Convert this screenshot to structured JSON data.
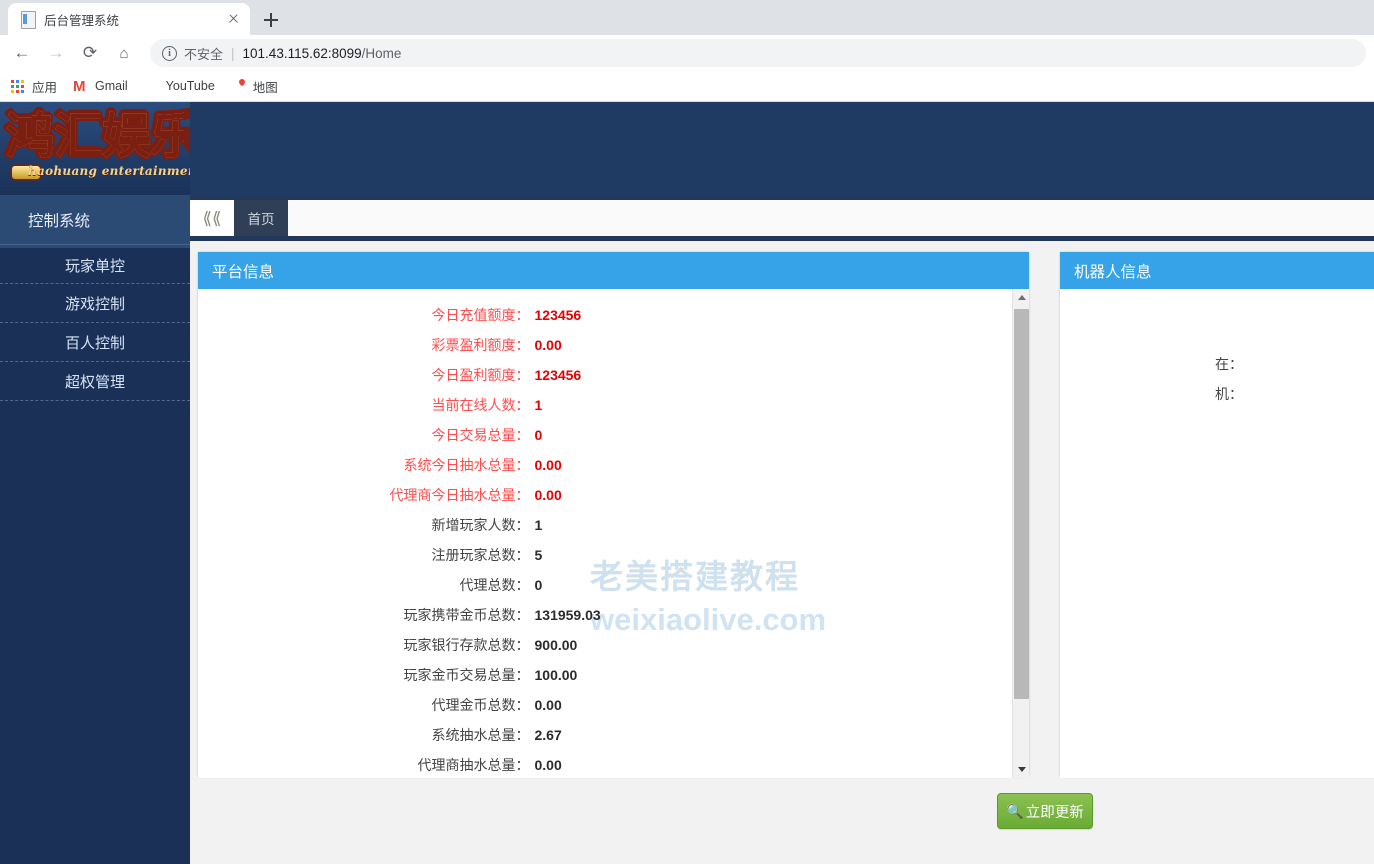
{
  "browser": {
    "tab": {
      "title": "后台管理系统",
      "favicon": "document-icon",
      "close": "close-icon"
    },
    "new_tab": "plus-icon",
    "nav": {
      "back": "arrow-left-icon",
      "forward": "arrow-right-icon",
      "reload": "reload-icon",
      "home": "home-icon"
    },
    "omnibox": {
      "info": "info-icon",
      "security_label": "不安全",
      "separator": "|",
      "host": "101.43.115.62:8099",
      "path": "/Home"
    },
    "bookmarks": [
      {
        "label": "应用",
        "icon": "apps-grid-icon"
      },
      {
        "label": "Gmail",
        "icon": "gmail-icon"
      },
      {
        "label": "YouTube",
        "icon": "youtube-icon"
      },
      {
        "label": "地图",
        "icon": "google-maps-icon"
      }
    ]
  },
  "app": {
    "logo": {
      "text": "鸿汇娱乐",
      "subtitle": "haohuang entertainment"
    },
    "sidebar": {
      "section_label": "控制系统",
      "items": [
        {
          "label": "玩家单控"
        },
        {
          "label": "游戏控制"
        },
        {
          "label": "百人控制"
        },
        {
          "label": "超权管理"
        }
      ]
    },
    "tabbar": {
      "collapse_icon": "chevron-double-left-icon",
      "tabs": [
        {
          "label": "首页",
          "active": true
        }
      ]
    },
    "panels": {
      "left": {
        "title": "平台信息",
        "rows": [
          {
            "label": "今日充值额度",
            "value": "123456",
            "style": "red"
          },
          {
            "label": "彩票盈利额度",
            "value": "0.00",
            "style": "red"
          },
          {
            "label": "今日盈利额度",
            "value": "123456",
            "style": "red"
          },
          {
            "label": "当前在线人数",
            "value": "1",
            "style": "red"
          },
          {
            "label": "今日交易总量",
            "value": "0",
            "style": "red"
          },
          {
            "label": "系统今日抽水总量",
            "value": "0.00",
            "style": "red"
          },
          {
            "label": "代理商今日抽水总量",
            "value": "0.00",
            "style": "red"
          },
          {
            "label": "新增玩家人数",
            "value": "1",
            "style": "dark"
          },
          {
            "label": "注册玩家总数",
            "value": "5",
            "style": "dark"
          },
          {
            "label": "代理总数",
            "value": "0",
            "style": "dark"
          },
          {
            "label": "玩家携带金币总数",
            "value": "131959.03",
            "style": "dark"
          },
          {
            "label": "玩家银行存款总数",
            "value": "900.00",
            "style": "dark"
          },
          {
            "label": "玩家金币交易总量",
            "value": "100.00",
            "style": "dark"
          },
          {
            "label": "代理金币总数",
            "value": "0.00",
            "style": "dark"
          },
          {
            "label": "系统抽水总量",
            "value": "2.67",
            "style": "dark"
          },
          {
            "label": "代理商抽水总量",
            "value": "0.00",
            "style": "dark"
          }
        ],
        "scrollbar": {
          "up": "triangle-up-icon",
          "down": "triangle-down-icon"
        }
      },
      "right": {
        "title": "机器人信息",
        "rows": [
          {
            "label": "在",
            "value": ""
          },
          {
            "label": "机",
            "value": ""
          }
        ]
      }
    },
    "update_button": {
      "label": "立即更新",
      "icon": "search-icon"
    },
    "watermark": {
      "line1": "老美搭建教程",
      "line2": "weixiaolive.com"
    },
    "colors": {
      "header_navy": "#1f3a63",
      "sidebar_navy": "#1b3057",
      "panel_blue": "#36a3e8",
      "tab_navy": "#2f4056",
      "value_red": "#e60000",
      "label_red": "#ff4d4d",
      "button_green": "#6aab35",
      "watermark_blue": "#cfe0ef"
    }
  }
}
